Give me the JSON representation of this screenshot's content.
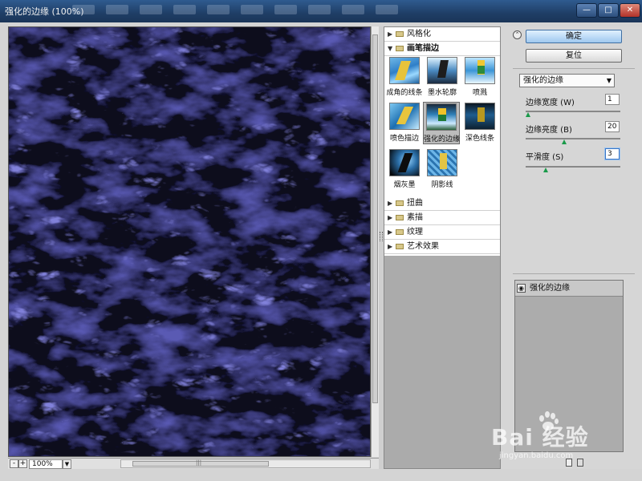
{
  "window": {
    "title": "强化的边缘 (100%)",
    "min_glyph": "—",
    "max_glyph": "□",
    "close_glyph": "✕"
  },
  "preview": {
    "zoom": "100%",
    "zoom_out": "-",
    "zoom_in": "+",
    "scroll_grip": "|||"
  },
  "gallery": {
    "categories_top": [
      {
        "label": "风格化",
        "expanded": false
      },
      {
        "label": "画笔描边",
        "expanded": true
      }
    ],
    "brush_filters": [
      {
        "label": "成角的线条",
        "selected": false
      },
      {
        "label": "墨水轮廓",
        "selected": false
      },
      {
        "label": "喷溅",
        "selected": false
      },
      {
        "label": "喷色描边",
        "selected": false
      },
      {
        "label": "强化的边缘",
        "selected": true
      },
      {
        "label": "深色线条",
        "selected": false
      },
      {
        "label": "烟灰墨",
        "selected": false
      },
      {
        "label": "阴影线",
        "selected": false
      }
    ],
    "categories_bottom": [
      {
        "label": "扭曲"
      },
      {
        "label": "素描"
      },
      {
        "label": "纹理"
      },
      {
        "label": "艺术效果"
      }
    ]
  },
  "panel": {
    "collapse_glyph": "⌃",
    "ok_label": "确定",
    "reset_label": "复位",
    "filter_select": "强化的边缘",
    "params": [
      {
        "label": "边缘宽度 (W)",
        "value": "1",
        "level": 0.0
      },
      {
        "label": "边缘亮度 (B)",
        "value": "20",
        "level": 0.4
      },
      {
        "label": "平滑度 (S)",
        "value": "3",
        "level": 0.2
      }
    ],
    "layer": {
      "name": "强化的边缘",
      "eye_glyph": "◉"
    }
  },
  "watermark": {
    "brand": "Bai 经验",
    "url": "jingyan.baidu.com"
  },
  "colors": {
    "preview_dark": "#0a0a22",
    "preview_blue": "#2a2a8a",
    "ok_accent": "#9fc8ef",
    "slider_knob": "#1a9a4a"
  }
}
